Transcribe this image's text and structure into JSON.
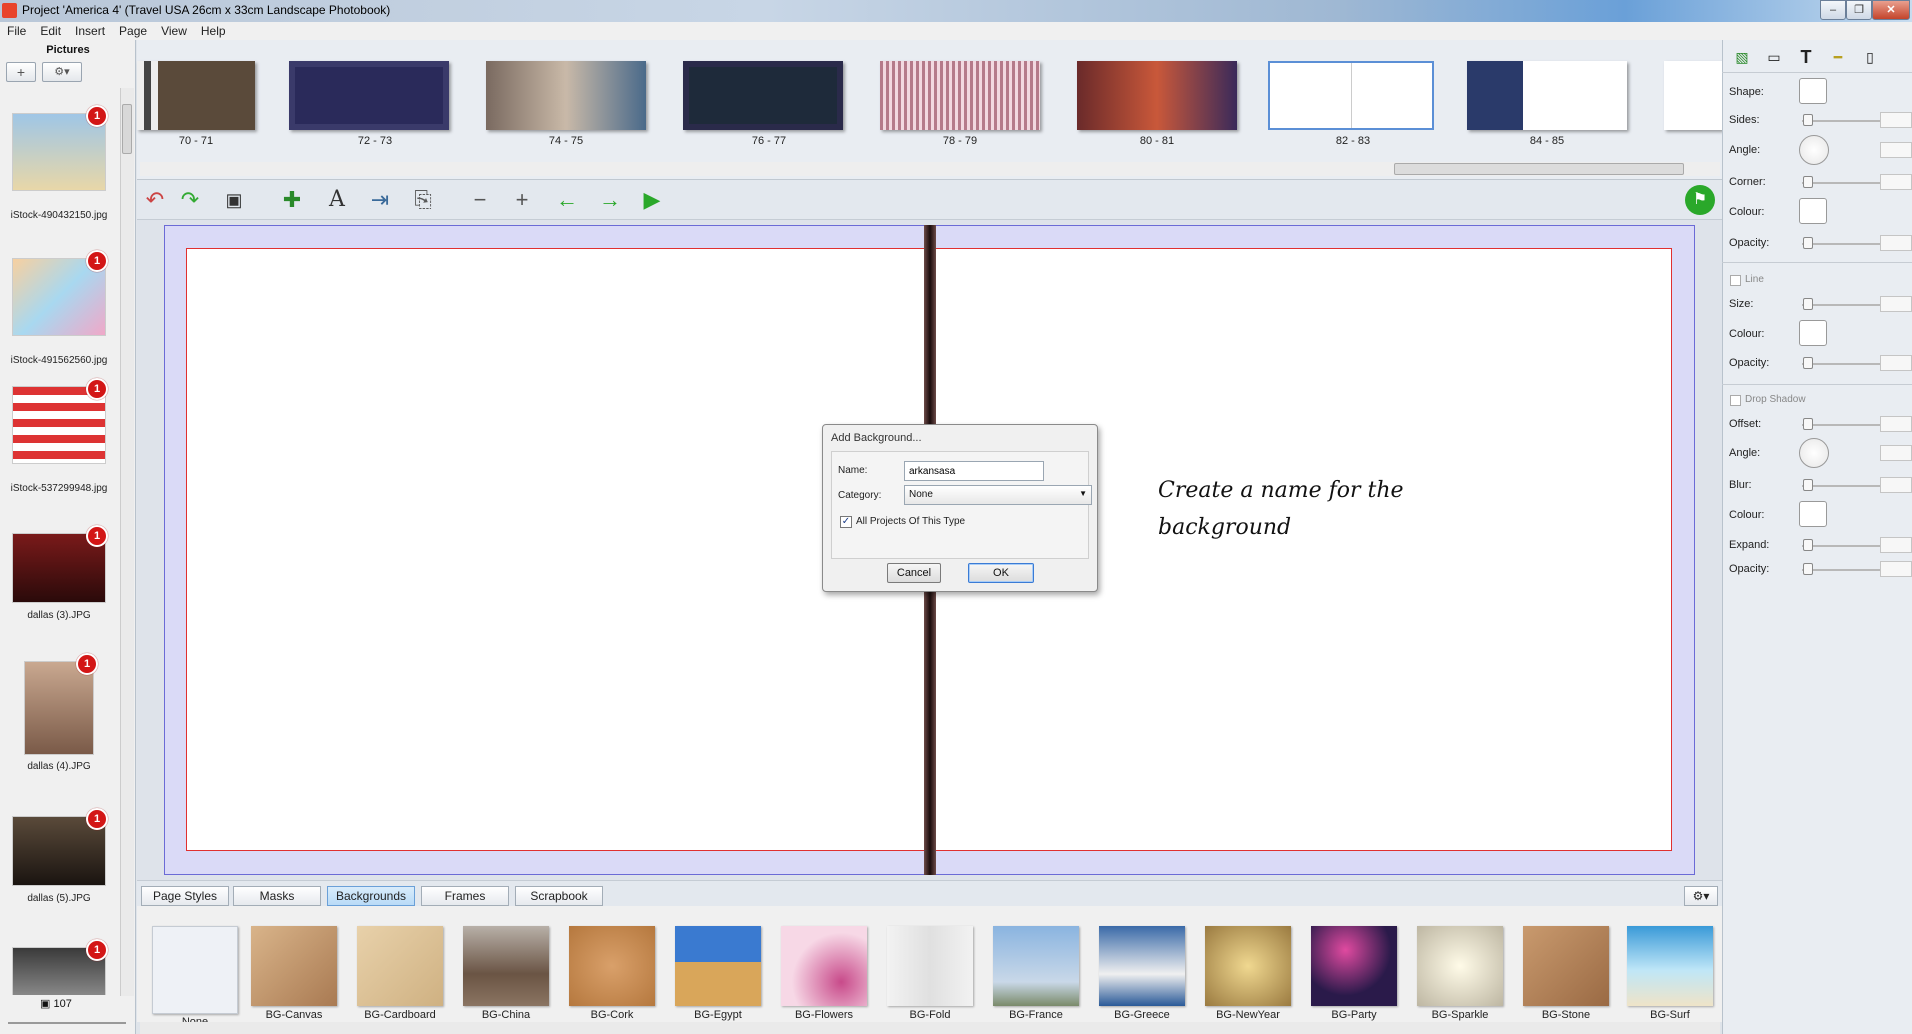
{
  "window": {
    "title": "Project 'America 4' (Travel USA 26cm x 33cm Landscape Photobook)",
    "minimize": "–",
    "restore": "❐",
    "close": "✕"
  },
  "menu": [
    "File",
    "Edit",
    "Insert",
    "Page",
    "View",
    "Help"
  ],
  "pictures_panel": {
    "heading": "Pictures",
    "add_label": "+",
    "gear_label": "⚙▾",
    "items": [
      {
        "file": "iStock-490432150.jpg",
        "badge": "1"
      },
      {
        "file": "iStock-491562560.jpg",
        "badge": "1"
      },
      {
        "file": "iStock-537299948.jpg",
        "badge": "1"
      },
      {
        "file": "dallas (3).JPG",
        "badge": "1"
      },
      {
        "file": "dallas (4).JPG",
        "badge": "1"
      },
      {
        "file": "dallas (5).JPG",
        "badge": "1"
      },
      {
        "file": "",
        "badge": "1"
      }
    ],
    "count": "107"
  },
  "spreads": [
    {
      "label": "70 - 71",
      "color": "#5a4a3a"
    },
    {
      "label": "72 - 73",
      "color": "#2a2a5a"
    },
    {
      "label": "74 - 75",
      "color": "#7a6a60"
    },
    {
      "label": "76 - 77",
      "color": "#1e2a3a"
    },
    {
      "label": "78 - 79",
      "color": "#8a5a6a"
    },
    {
      "label": "80 - 81",
      "color": "#6a2a2a"
    },
    {
      "label": "82 - 83",
      "color": "#ffffff",
      "selected": true
    },
    {
      "label": "84 - 85",
      "color": "#2a3a6a"
    }
  ],
  "toolbar": {
    "icons": [
      "undo-icon",
      "redo-icon",
      "save-icon",
      "add-picture-icon",
      "add-text-icon",
      "export-icon",
      "share-icon",
      "zoom-out-icon",
      "zoom-in-icon",
      "previous-page-icon",
      "next-page-icon",
      "play-icon",
      "cart-icon"
    ],
    "glyphs": [
      "↶",
      "↷",
      "💾",
      "✚",
      "A",
      "⇥",
      "⎘",
      "−",
      "+",
      "←",
      "→",
      "▶",
      "🛒"
    ]
  },
  "annotation": {
    "line1": "Create a name for the",
    "line2": "background"
  },
  "dialog": {
    "title": "Add Background...",
    "name_label": "Name:",
    "name_value": "arkansasa",
    "category_label": "Category:",
    "category_value": "None",
    "checkbox_label": "All Projects Of This Type",
    "checkbox_checked": true,
    "checkbox_mark": "✓",
    "cancel": "Cancel",
    "ok": "OK"
  },
  "tabs": [
    {
      "label": "Page Styles"
    },
    {
      "label": "Masks"
    },
    {
      "label": "Backgrounds",
      "active": true
    },
    {
      "label": "Frames"
    },
    {
      "label": "Scrapbook"
    }
  ],
  "backgrounds": [
    {
      "name": "None",
      "color": "#eef1f6"
    },
    {
      "name": "BG-Canvas",
      "color": "#c9a27a"
    },
    {
      "name": "BG-Cardboard",
      "color": "#dcc39a"
    },
    {
      "name": "BG-China",
      "color": "#8a7462"
    },
    {
      "name": "BG-Cork",
      "color": "#c98f5a"
    },
    {
      "name": "BG-Egypt",
      "color": "#d9a65a"
    },
    {
      "name": "BG-Flowers",
      "color": "#f4c9da"
    },
    {
      "name": "BG-Fold",
      "color": "#e9e9e9"
    },
    {
      "name": "BG-France",
      "color": "#9ab8d8"
    },
    {
      "name": "BG-Greece",
      "color": "#6f8fb6"
    },
    {
      "name": "BG-NewYear",
      "color": "#c9b080"
    },
    {
      "name": "BG-Party",
      "color": "#3a2a5a"
    },
    {
      "name": "BG-Sparkle",
      "color": "#d9d4c4"
    },
    {
      "name": "BG-Stone",
      "color": "#b58a62"
    },
    {
      "name": "BG-Surf",
      "color": "#7fc2e6"
    }
  ],
  "properties": {
    "shape_label": "Shape:",
    "sides_label": "Sides:",
    "angle_label": "Angle:",
    "corner_label": "Corner:",
    "colour_label": "Colour:",
    "opacity_label": "Opacity:",
    "line_heading": "Line",
    "size_label": "Size:",
    "line_colour_label": "Colour:",
    "line_opacity_label": "Opacity:",
    "shadow_heading": "Drop Shadow",
    "offset_label": "Offset:",
    "shadow_angle_label": "Angle:",
    "blur_label": "Blur:",
    "shadow_colour_label": "Colour:",
    "expand_label": "Expand:",
    "shadow_opacity_label": "Opacity:"
  },
  "right_tabs": [
    "▧",
    "▭",
    "T",
    "━",
    "▯"
  ]
}
